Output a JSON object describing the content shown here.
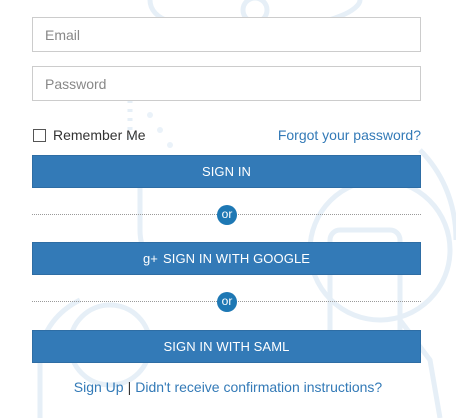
{
  "form": {
    "email": {
      "value": "",
      "placeholder": "Email"
    },
    "password": {
      "value": "",
      "placeholder": "Password"
    },
    "remember_label": "Remember Me",
    "remember_checked": false,
    "forgot_link": "Forgot your password?"
  },
  "buttons": {
    "sign_in": "SIGN IN",
    "google_icon_text": "g+",
    "sign_in_google": "SIGN IN WITH GOOGLE",
    "sign_in_saml": "SIGN IN WITH SAML"
  },
  "dividers": {
    "or_1": "or",
    "or_2": "or"
  },
  "footer": {
    "sign_up": "Sign Up",
    "separator": "|",
    "confirmation": "Didn't receive confirmation instructions?"
  },
  "colors": {
    "primary": "#337ab7",
    "or_badge": "#1e78b4",
    "decor": "#e3eef6"
  },
  "icons": {
    "google_plus": "google-plus-icon"
  }
}
